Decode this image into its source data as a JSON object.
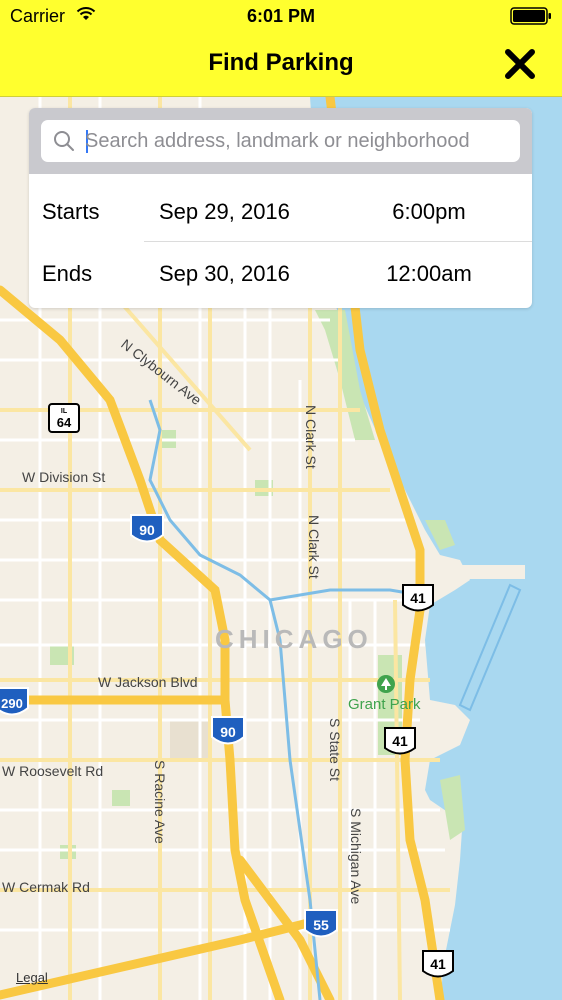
{
  "status_bar": {
    "carrier": "Carrier",
    "time": "6:01 PM"
  },
  "nav": {
    "title": "Find Parking",
    "close_icon": "close-icon"
  },
  "search": {
    "placeholder": "Search address, landmark or neighborhood",
    "value": ""
  },
  "schedule": {
    "start": {
      "label": "Starts",
      "date": "Sep 29, 2016",
      "time": "6:00pm"
    },
    "end": {
      "label": "Ends",
      "date": "Sep 30, 2016",
      "time": "12:00am"
    }
  },
  "map": {
    "city_label": "CHICAGO",
    "streets": {
      "clybourn": "N Clybourn Ave",
      "division": "W Division St",
      "jackson": "W Jackson Blvd",
      "roosevelt": "W Roosevelt Rd",
      "cermak": "W Cermak Rd",
      "racine": "S Racine Ave",
      "state": "S State St",
      "michigan": "S Michigan Ave",
      "clark_a": "N Clark St",
      "clark_b": "N Clark St"
    },
    "park": "Grant Park",
    "shields": {
      "il64_top": "IL",
      "il64": "64",
      "i90_a": "90",
      "i90_b": "90",
      "i290": "290",
      "i55": "55",
      "us41_a": "41",
      "us41_b": "41",
      "us41_c": "41"
    },
    "legal": "Legal"
  },
  "colors": {
    "nav_bg": "#ffff2e",
    "water": "#a9d8f0",
    "land": "#f4efe5",
    "highway": "#f9c842",
    "park": "#c9e5b3"
  }
}
